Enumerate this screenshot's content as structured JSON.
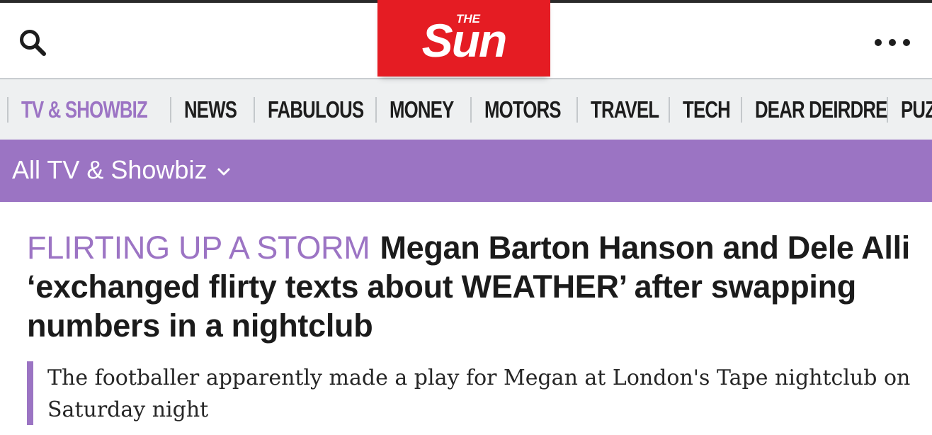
{
  "header": {
    "logo": {
      "small_text": "THE",
      "main_text": "Sun"
    },
    "search_icon": "search-icon",
    "more_icon": "more-horizontal-icon"
  },
  "nav": {
    "items": [
      {
        "label": "TV & SHOWBIZ",
        "active": true
      },
      {
        "label": "NEWS",
        "active": false
      },
      {
        "label": "FABULOUS",
        "active": false
      },
      {
        "label": "MONEY",
        "active": false
      },
      {
        "label": "MOTORS",
        "active": false
      },
      {
        "label": "TRAVEL",
        "active": false
      },
      {
        "label": "TECH",
        "active": false
      },
      {
        "label": "DEAR DEIRDRE",
        "active": false
      },
      {
        "label": "PUZZLES",
        "active": false
      }
    ]
  },
  "section": {
    "label": "All TV & Showbiz",
    "chevron_icon": "chevron-down-icon"
  },
  "article": {
    "kicker": "FLIRTING UP A STORM",
    "headline": "Megan Barton Hanson and Dele Alli ‘exchanged flirty texts about WEATHER’ after swapping numbers in a nightclub",
    "standfirst": "The footballer apparently made a play for Megan at London's Tape nightclub on Saturday night"
  },
  "colors": {
    "brand_red": "#e51c23",
    "accent_purple": "#9b74c3",
    "nav_background": "#eef0f1",
    "text_dark": "#1b1b1b"
  }
}
